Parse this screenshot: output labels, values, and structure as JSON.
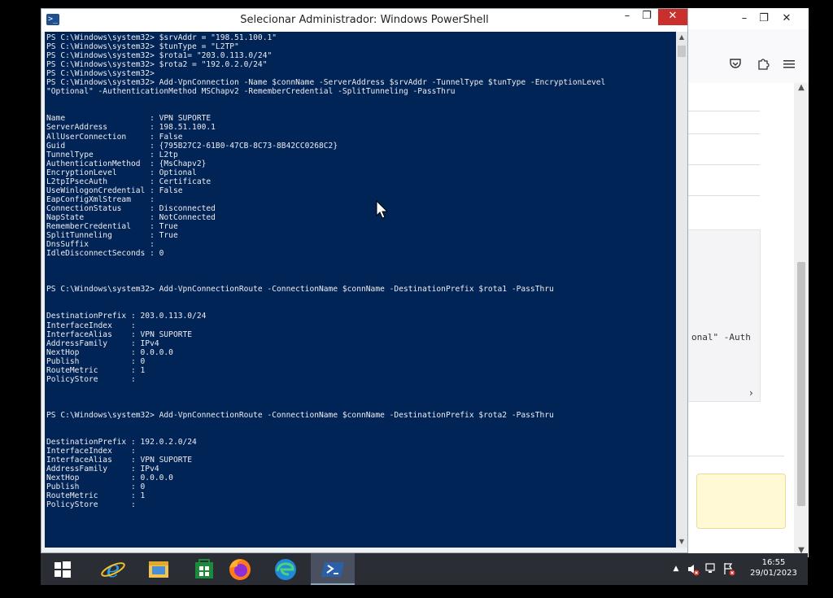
{
  "ps_window": {
    "title": "Selecionar Administrador: Windows PowerShell",
    "icon": "powershell-icon",
    "minimize": "–",
    "maximize": "❐",
    "close": "✕"
  },
  "console_lines": [
    "PS C:\\Windows\\system32> $srvAddr = \"198.51.100.1\"",
    "PS C:\\Windows\\system32> $tunType = \"L2TP\"",
    "PS C:\\Windows\\system32> $rota1= \"203.0.113.0/24\"",
    "PS C:\\Windows\\system32> $rota2 = \"192.0.2.0/24\"",
    "PS C:\\Windows\\system32>",
    "PS C:\\Windows\\system32> Add-VpnConnection -Name $connName -ServerAddress $srvAddr -TunnelType $tunType -EncryptionLevel",
    "\"Optional\" -AuthenticationMethod MSChapv2 -RememberCredential -SplitTunneling -PassThru",
    "",
    "",
    "Name                  : VPN SUPORTE",
    "ServerAddress         : 198.51.100.1",
    "AllUserConnection     : False",
    "Guid                  : {795B27C2-61B0-47CB-8C73-8B42CC0268C2}",
    "TunnelType            : L2tp",
    "AuthenticationMethod  : {MsChapv2}",
    "EncryptionLevel       : Optional",
    "L2tpIPsecAuth         : Certificate",
    "UseWinlogonCredential : False",
    "EapConfigXmlStream    :",
    "ConnectionStatus      : Disconnected",
    "NapState              : NotConnected",
    "RememberCredential    : True",
    "SplitTunneling        : True",
    "DnsSuffix             :",
    "IdleDisconnectSeconds : 0",
    "",
    "",
    "",
    "PS C:\\Windows\\system32> Add-VpnConnectionRoute -ConnectionName $connName -DestinationPrefix $rota1 -PassThru",
    "",
    "",
    "DestinationPrefix : 203.0.113.0/24",
    "InterfaceIndex    :",
    "InterfaceAlias    : VPN SUPORTE",
    "AddressFamily     : IPv4",
    "NextHop           : 0.0.0.0",
    "Publish           : 0",
    "RouteMetric       : 1",
    "PolicyStore       :",
    "",
    "",
    "",
    "PS C:\\Windows\\system32> Add-VpnConnectionRoute -ConnectionName $connName -DestinationPrefix $rota2 -PassThru",
    "",
    "",
    "DestinationPrefix : 192.0.2.0/24",
    "InterfaceIndex    :",
    "InterfaceAlias    : VPN SUPORTE",
    "AddressFamily     : IPv4",
    "NextHop           : 0.0.0.0",
    "Publish           : 0",
    "RouteMetric       : 1",
    "PolicyStore       :",
    "",
    "",
    "",
    "",
    ""
  ],
  "prompt": "PS C:\\Windows\\system32> ",
  "background_window": {
    "code_fragment": "onal\" -Auth",
    "toolbar_icons": [
      "pocket-icon",
      "extensions-icon",
      "menu-icon"
    ]
  },
  "taskbar": {
    "apps": [
      "start-button",
      "internet-explorer-icon",
      "file-explorer-icon",
      "store-icon",
      "firefox-icon",
      "edge-icon",
      "powershell-icon"
    ],
    "active_app": "powershell-icon",
    "time": "16:55",
    "date": "29/01/2023"
  },
  "colors": {
    "console_bg": "#012456",
    "console_fg": "#eeedf0",
    "close_btn": "#c9302c",
    "taskbar": "#2a2d33"
  }
}
